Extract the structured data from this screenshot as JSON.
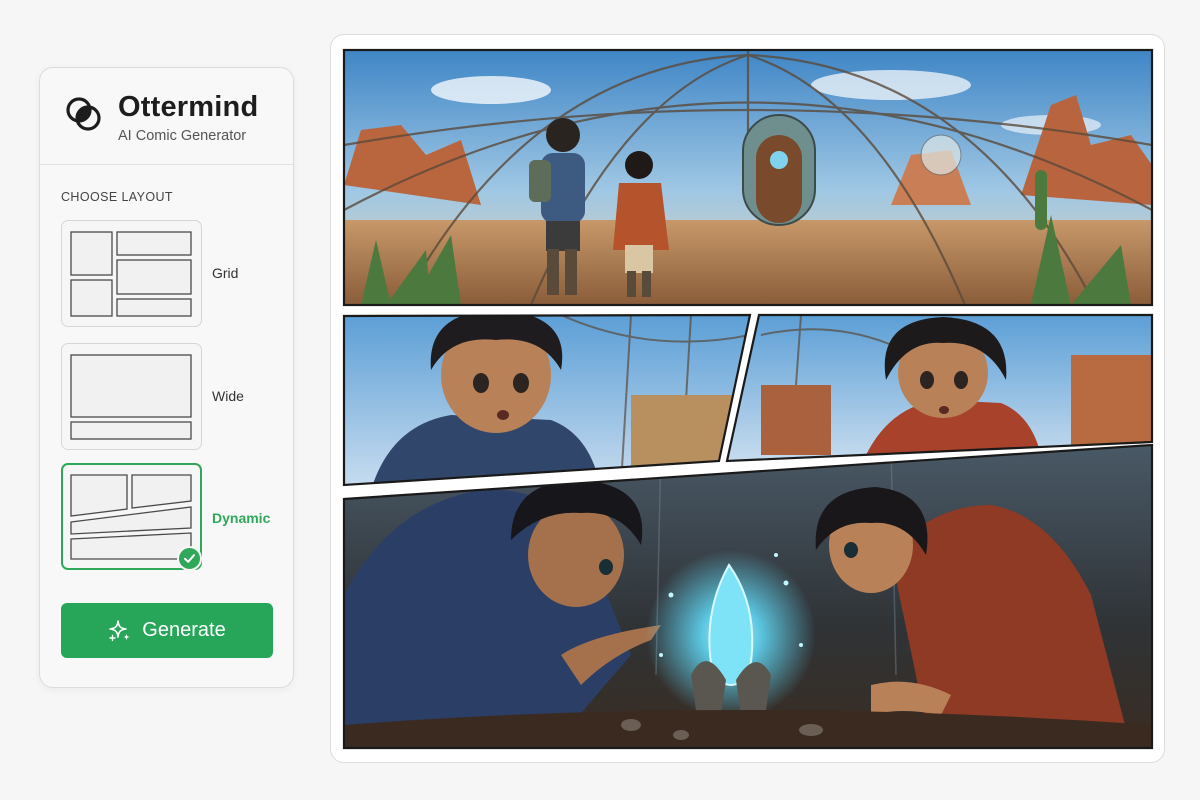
{
  "app": {
    "name": "Ottermind",
    "tagline": "AI Comic Generator"
  },
  "layout_picker": {
    "section_label": "CHOOSE LAYOUT",
    "options": [
      {
        "label": "Grid",
        "selected": false
      },
      {
        "label": "Wide",
        "selected": false
      },
      {
        "label": "Dynamic",
        "selected": true
      }
    ]
  },
  "generate_button": {
    "label": "Generate",
    "icon": "sparkle-icon"
  },
  "comic": {
    "layout": "Dynamic",
    "panels": [
      {
        "name": "panel-greenhouse-wide",
        "scene": "Two children standing inside a glass dome greenhouse in a desert canyon"
      },
      {
        "name": "panel-boy-closeup",
        "scene": "Close-up of a surprised boy in a blue hoodie"
      },
      {
        "name": "panel-girl-closeup",
        "scene": "Close-up of a surprised girl in a red scarf"
      },
      {
        "name": "panel-glowing-crystal",
        "scene": "Both children leaning over a glowing blue crystal on the ground"
      }
    ]
  },
  "colors": {
    "accent": "#27a65a",
    "accent_text": "#2fa85a",
    "panel_border": "#1a1a1a"
  }
}
